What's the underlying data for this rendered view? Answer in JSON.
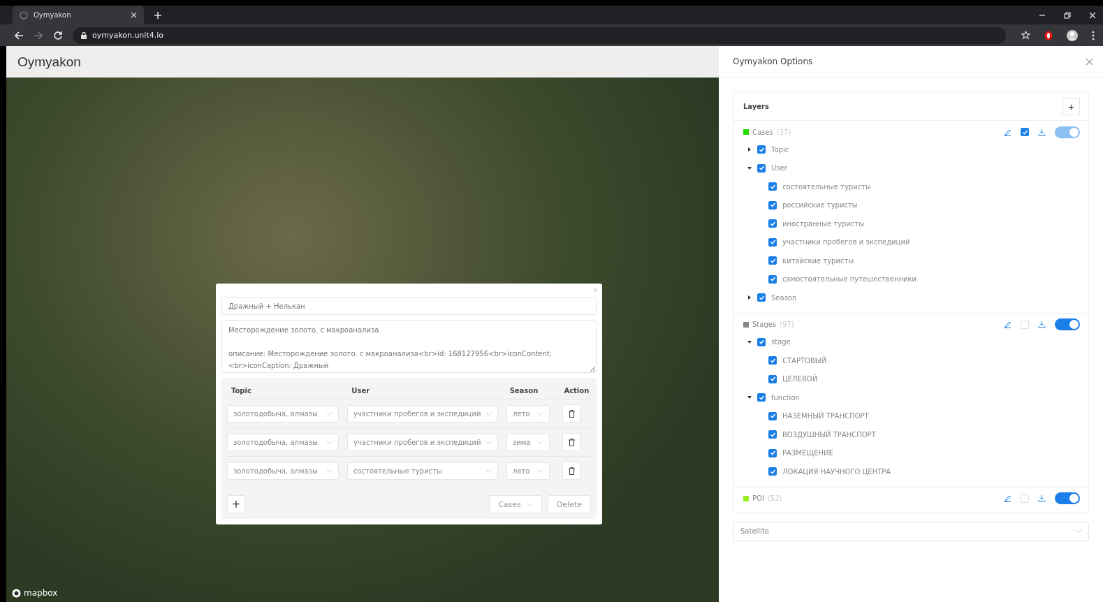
{
  "browser": {
    "tab_title": "Oymyakon",
    "url": "oymyakon.unit4.io"
  },
  "app": {
    "title": "Oymyakon",
    "map_attribution": "mapbox"
  },
  "popup": {
    "title_value": "Дражный + Нелькан",
    "description_value": "Месторождение золото. с макроанализа\n\nописание: Месторождение золото. с макроанализа<br>id: 168127956<br>iconContent:\n<br>iconCaption: Дражный",
    "columns": [
      "Topic",
      "User",
      "Season",
      "Action"
    ],
    "rows": [
      {
        "topic": "золотодобыча, алмазы",
        "user": "участники пробегов и экспедиций",
        "season": "лето"
      },
      {
        "topic": "золотодобыча, алмазы",
        "user": "участники пробегов и экспедиций",
        "season": "зима"
      },
      {
        "topic": "золотодобыча, алмазы",
        "user": "состоятельные туристы",
        "season": "лето"
      }
    ],
    "add_label": "+",
    "layer_select": "Cases",
    "delete_label": "Delete"
  },
  "options": {
    "title": "Oymyakon Options",
    "layers_title": "Layers",
    "add_label": "+",
    "layers": [
      {
        "name": "Cases",
        "count": "(37)",
        "color": "#22dd00",
        "checked": true,
        "visible": true,
        "disabled": true,
        "children": [
          {
            "label": "Topic",
            "checked": true,
            "expanded": false
          },
          {
            "label": "User",
            "checked": true,
            "expanded": true,
            "children": [
              {
                "label": "состоятельные туристы",
                "checked": true
              },
              {
                "label": "российские туристы",
                "checked": true
              },
              {
                "label": "иностранные туристы",
                "checked": true
              },
              {
                "label": "участники пробегов и экспедиций",
                "checked": true
              },
              {
                "label": "китайские туристы",
                "checked": true
              },
              {
                "label": "самостоятельные путешественники",
                "checked": true
              }
            ]
          },
          {
            "label": "Season",
            "checked": true,
            "expanded": false
          }
        ]
      },
      {
        "name": "Stages",
        "count": "(97)",
        "color": "#888888",
        "checked": false,
        "visible": true,
        "disabled": false,
        "children": [
          {
            "label": "stage",
            "checked": true,
            "expanded": true,
            "children": [
              {
                "label": "СТАРТОВЫЙ",
                "checked": true
              },
              {
                "label": "ЦЕЛЕВОЙ",
                "checked": true
              }
            ]
          },
          {
            "label": "function",
            "checked": true,
            "expanded": true,
            "children": [
              {
                "label": "НАЗЕМНЫЙ ТРАНСПОРТ",
                "checked": true
              },
              {
                "label": "ВОЗДУШНЫЙ ТРАНСПОРТ",
                "checked": true
              },
              {
                "label": "РАЗМЕЩЕНИЕ",
                "checked": true
              },
              {
                "label": "ЛОКАЦИЯ НАУЧНОГО ЦЕНТРА",
                "checked": true
              }
            ]
          }
        ]
      },
      {
        "name": "POI",
        "count": "(52)",
        "color": "#99ee22",
        "checked": false,
        "visible": true,
        "disabled": false
      }
    ],
    "basemap": "Satellite"
  }
}
